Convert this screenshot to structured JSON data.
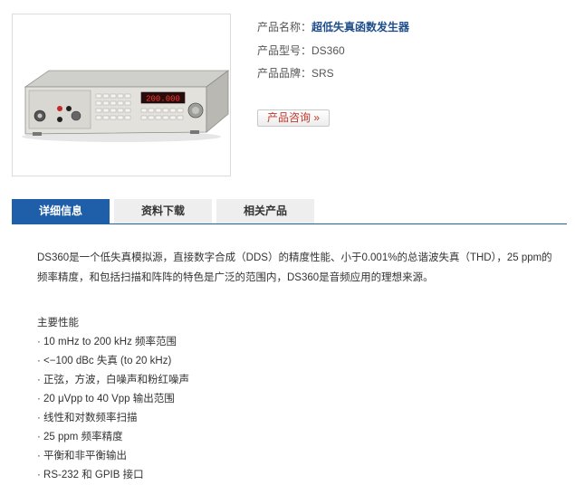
{
  "product": {
    "name_label": "产品名称：",
    "name_value": "超低失真函数发生器",
    "model_label": "产品型号：",
    "model_value": "DS360",
    "brand_label": "产品品牌：",
    "brand_value": "SRS",
    "consult_button": "产品咨询 »",
    "display_readout": "200.000"
  },
  "tabs": [
    {
      "label": "详细信息",
      "active": true
    },
    {
      "label": "资料下载",
      "active": false
    },
    {
      "label": "相关产品",
      "active": false
    }
  ],
  "content": {
    "description": "DS360是一个低失真模拟源，直接数字合成（DDS）的精度性能、小于0.001%的总谐波失真（THD），25 ppm的频率精度，和包括扫描和阵阵的特色是广泛的范围内，DS360是音频应用的理想来源。",
    "features_title": "主要性能",
    "features": [
      "· 10 mHz to 200 kHz 频率范围",
      "· <−100 dBc 失真 (to 20 kHz)",
      "· 正弦，方波，白噪声和粉红噪声",
      "· 20 μVpp to 40 Vpp 输出范围",
      "· 线性和对数频率扫描",
      "· 25 ppm 频率精度",
      "· 平衡和非平衡输出",
      "· RS-232 和 GPIB 接口"
    ]
  },
  "colors": {
    "accent": "#1f5ea8",
    "product_name": "#1f4e8c",
    "consult_text": "#c0392b"
  }
}
